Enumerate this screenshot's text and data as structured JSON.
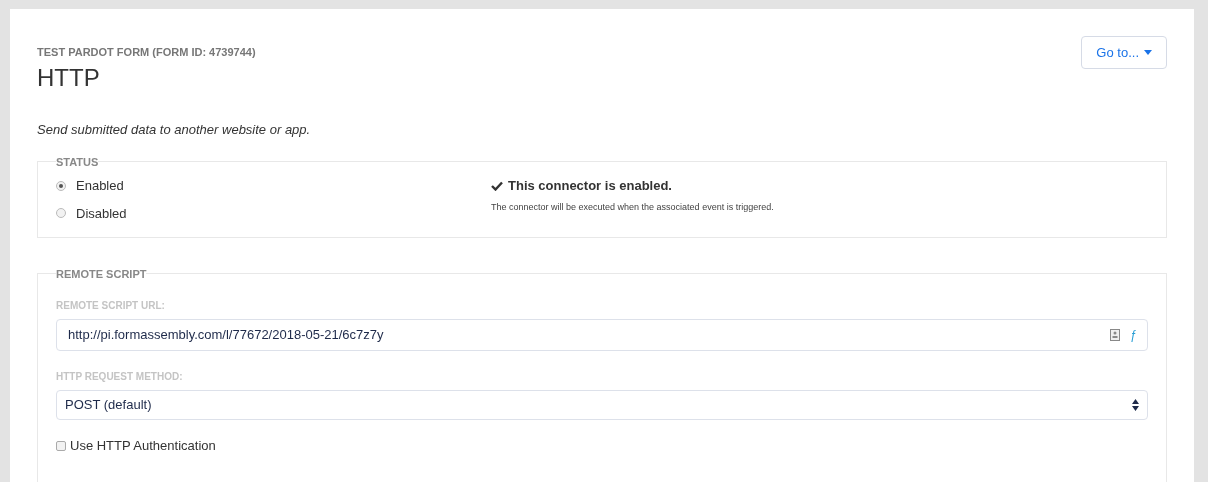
{
  "header": {
    "form_name": "TEST PARDOT FORM (FORM ID: 4739744)",
    "title": "HTTP",
    "goto_button": "Go to..."
  },
  "description": "Send submitted data to another website or app.",
  "status": {
    "legend": "STATUS",
    "options": [
      {
        "label": "Enabled",
        "selected": true
      },
      {
        "label": "Disabled",
        "selected": false
      }
    ],
    "message_title": "This connector is enabled.",
    "message_body": "The connector will be executed when the associated event is triggered."
  },
  "remote_script": {
    "legend": "REMOTE SCRIPT",
    "url_label": "REMOTE SCRIPT URL:",
    "url_value": "http://pi.formassembly.com/l/77672/2018-05-21/6c7z7y",
    "function_glyph": "ƒ",
    "method_label": "HTTP REQUEST METHOD:",
    "method_value": "POST (default)",
    "auth": {
      "label": "Use HTTP Authentication",
      "checked": false
    }
  }
}
